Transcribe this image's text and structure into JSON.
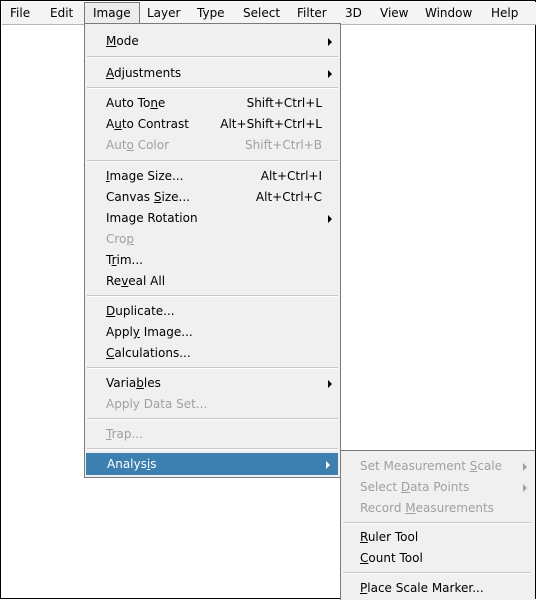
{
  "menubar": {
    "items": [
      "File",
      "Edit",
      "Image",
      "Layer",
      "Type",
      "Select",
      "Filter",
      "3D",
      "View",
      "Window",
      "Help"
    ],
    "active": "Image"
  },
  "image_menu": {
    "mode": {
      "pre": "",
      "u": "M",
      "post": "ode"
    },
    "adjustments": {
      "pre": "",
      "u": "A",
      "post": "djustments"
    },
    "auto_tone": {
      "pre": "Auto To",
      "u": "n",
      "post": "e",
      "shortcut": "Shift+Ctrl+L"
    },
    "auto_contrast": {
      "pre": "A",
      "u": "u",
      "post": "to Contrast",
      "shortcut": "Alt+Shift+Ctrl+L"
    },
    "auto_color": {
      "pre": "Aut",
      "u": "o",
      "post": " Color",
      "shortcut": "Shift+Ctrl+B"
    },
    "image_size": {
      "pre": "",
      "u": "I",
      "post": "mage Size...",
      "shortcut": "Alt+Ctrl+I"
    },
    "canvas_size": {
      "pre": "Canvas ",
      "u": "S",
      "post": "ize...",
      "shortcut": "Alt+Ctrl+C"
    },
    "image_rotation": {
      "pre": "Image Rotation",
      "u": "",
      "post": ""
    },
    "crop": {
      "pre": "Cro",
      "u": "p",
      "post": ""
    },
    "trim": {
      "pre": "T",
      "u": "r",
      "post": "im..."
    },
    "reveal_all": {
      "pre": "Re",
      "u": "v",
      "post": "eal All"
    },
    "duplicate": {
      "pre": "",
      "u": "D",
      "post": "uplicate..."
    },
    "apply_image": {
      "pre": "Appl",
      "u": "y",
      "post": " Image..."
    },
    "calculations": {
      "pre": "",
      "u": "C",
      "post": "alculations..."
    },
    "variables": {
      "pre": "Varia",
      "u": "b",
      "post": "les"
    },
    "apply_data_set": {
      "pre": "Apply Data Set...",
      "u": "",
      "post": ""
    },
    "trap": {
      "pre": "",
      "u": "T",
      "post": "rap..."
    },
    "analysis": {
      "pre": "Analys",
      "u": "i",
      "post": "s"
    }
  },
  "analysis_submenu": {
    "set_measurement_scale": {
      "pre": "Set Measurement ",
      "u": "S",
      "post": "cale"
    },
    "select_data_points": {
      "pre": "Select ",
      "u": "D",
      "post": "ata Points"
    },
    "record_measurements": {
      "pre": "Record ",
      "u": "M",
      "post": "easurements"
    },
    "ruler_tool": {
      "pre": "",
      "u": "R",
      "post": "uler Tool"
    },
    "count_tool": {
      "pre": "",
      "u": "C",
      "post": "ount Tool"
    },
    "place_scale_marker": {
      "pre": "",
      "u": "P",
      "post": "lace Scale Marker..."
    }
  }
}
